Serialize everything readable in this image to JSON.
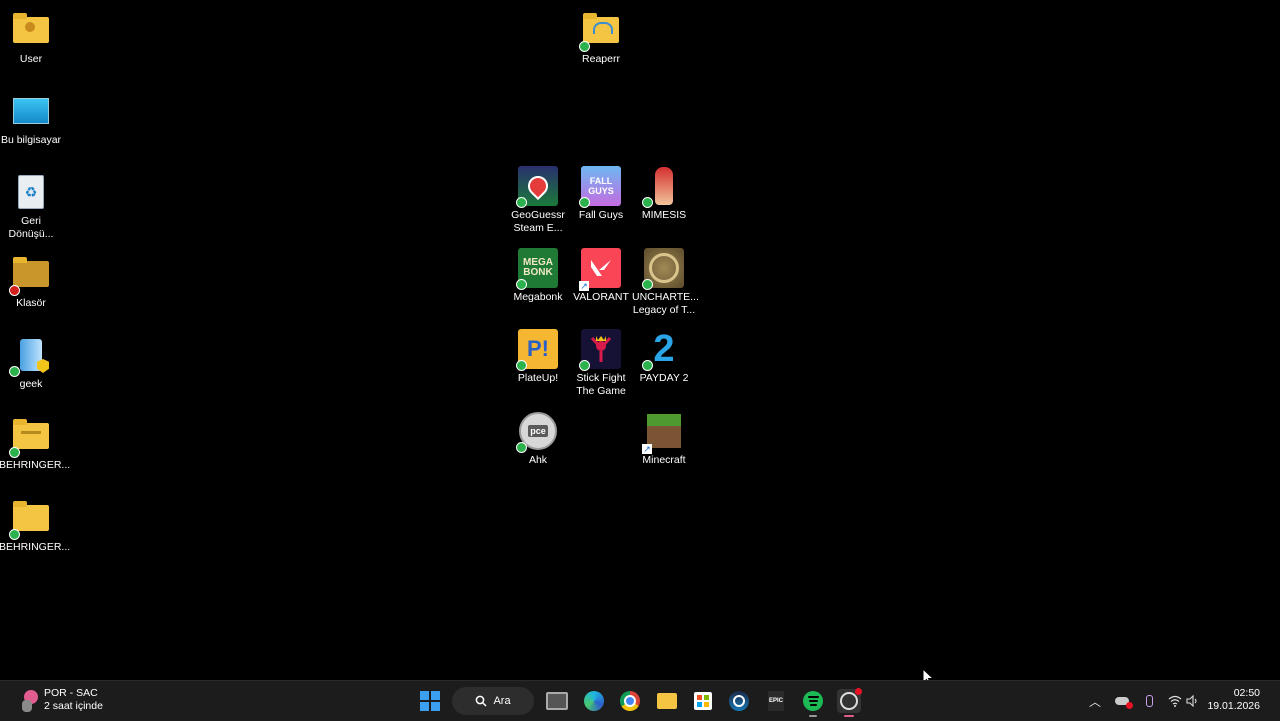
{
  "desktop": {
    "left_icons": [
      {
        "label": "User",
        "icon": "user-folder-icon"
      },
      {
        "label": "Bu bilgisayar",
        "icon": "computer-icon"
      },
      {
        "label": "Geri\nDönüşü...",
        "icon": "recycle-bin-icon"
      },
      {
        "label": "Klasör",
        "icon": "folder-icon"
      },
      {
        "label": "geek",
        "icon": "geek-uninstaller-icon"
      },
      {
        "label": "BEHRINGER...",
        "icon": "zip-folder-icon"
      },
      {
        "label": "BEHRINGER...",
        "icon": "folder-icon"
      }
    ],
    "center_icons": [
      {
        "label": "Reaperr",
        "icon": "folder-icon"
      },
      {
        "label": "GeoGuessr\nSteam E...",
        "icon": "geoguessr-icon"
      },
      {
        "label": "Fall Guys",
        "icon": "fall-guys-icon"
      },
      {
        "label": "MIMESIS",
        "icon": "mimesis-icon"
      },
      {
        "label": "Megabonk",
        "icon": "megabonk-icon"
      },
      {
        "label": "VALORANT",
        "icon": "valorant-icon"
      },
      {
        "label": "UNCHARTE...\nLegacy of T...",
        "icon": "uncharted-icon"
      },
      {
        "label": "PlateUp!",
        "icon": "plateup-icon"
      },
      {
        "label": "Stick Fight\nThe Game",
        "icon": "stick-fight-icon"
      },
      {
        "label": "PAYDAY 2",
        "icon": "payday-icon"
      },
      {
        "label": "Ahk",
        "icon": "ahk-icon"
      },
      {
        "label": "Minecraft",
        "icon": "minecraft-icon"
      }
    ],
    "tile_texts": {
      "fall_guys": "FALL GUYS",
      "megabonk": "MEGA BONK",
      "plateup": "P!",
      "ahk": "pce",
      "payday": "2"
    }
  },
  "taskbar": {
    "weather": {
      "line1": "POR - SAC",
      "line2": "2 saat içinde"
    },
    "search_label": "Ara",
    "epic_label": "EPIC",
    "clock": {
      "time": "02:50",
      "date": "19.01.2026"
    }
  }
}
